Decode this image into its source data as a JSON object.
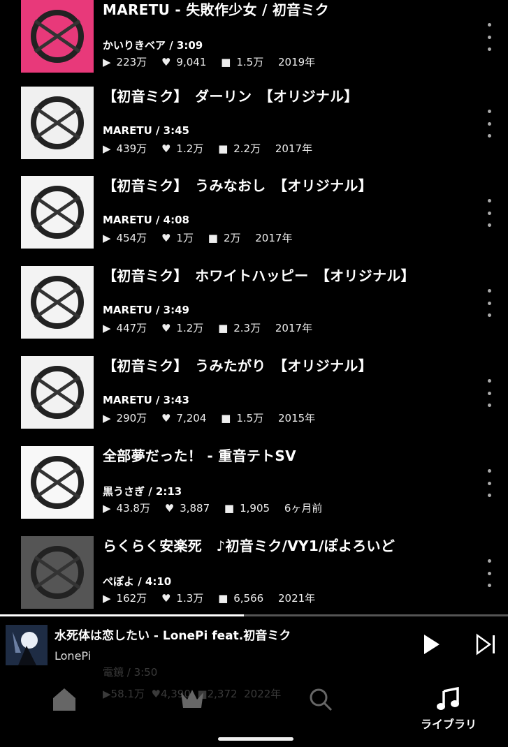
{
  "tracks": [
    {
      "title": "MARETU - 失敗作少女 / 初音ミク",
      "meta": "かいりきベア / 3:09",
      "plays": "223万",
      "likes": "9,041",
      "saves": "1.5万",
      "date": "2019年"
    },
    {
      "title": "【初音ミク】　ダーリン　【オリジナル】",
      "meta": "MARETU / 3:45",
      "plays": "439万",
      "likes": "1.2万",
      "saves": "2.2万",
      "date": "2017年"
    },
    {
      "title": "【初音ミク】　うみなおし　【オリジナル】",
      "meta": "MARETU / 4:08",
      "plays": "454万",
      "likes": "1万",
      "saves": "2万",
      "date": "2017年"
    },
    {
      "title": "【初音ミク】　ホワイトハッピー　【オリジナル】",
      "meta": "MARETU / 3:49",
      "plays": "447万",
      "likes": "1.2万",
      "saves": "2.3万",
      "date": "2017年"
    },
    {
      "title": "【初音ミク】　うみたがり　【オリジナル】",
      "meta": "MARETU / 3:43",
      "plays": "290万",
      "likes": "7,204",
      "saves": "1.5万",
      "date": "2015年"
    },
    {
      "title": "全部夢だった！ - 重音テトSV",
      "meta": "黒うさぎ / 2:13",
      "plays": "43.8万",
      "likes": "3,887",
      "saves": "1,905",
      "date": "6ヶ月前"
    },
    {
      "title": "らくらく安楽死　♪初音ミク/VY1/ぽよろいど",
      "meta": "ぺぽよ / 4:10",
      "plays": "162万",
      "likes": "1.3万",
      "saves": "6,566",
      "date": "2021年"
    }
  ],
  "partial_track": {
    "meta": "電鏡 / 3:50",
    "plays": "58.1万",
    "likes": "4,390",
    "saves": "2,372",
    "date": "2022年"
  },
  "icons": {
    "play": "play-icon",
    "like": "heart-icon",
    "save": "folder-icon",
    "more": "more-vertical-icon"
  },
  "now_playing": {
    "title": "水死体は恋したい - LonePi feat.初音ミク",
    "artist": "LonePi",
    "progress": 0.48
  },
  "nav": {
    "library_label": "ライブラリ"
  },
  "colors": {
    "background": "#000000",
    "text": "#ffffff",
    "muted": "#aaaaaa"
  }
}
